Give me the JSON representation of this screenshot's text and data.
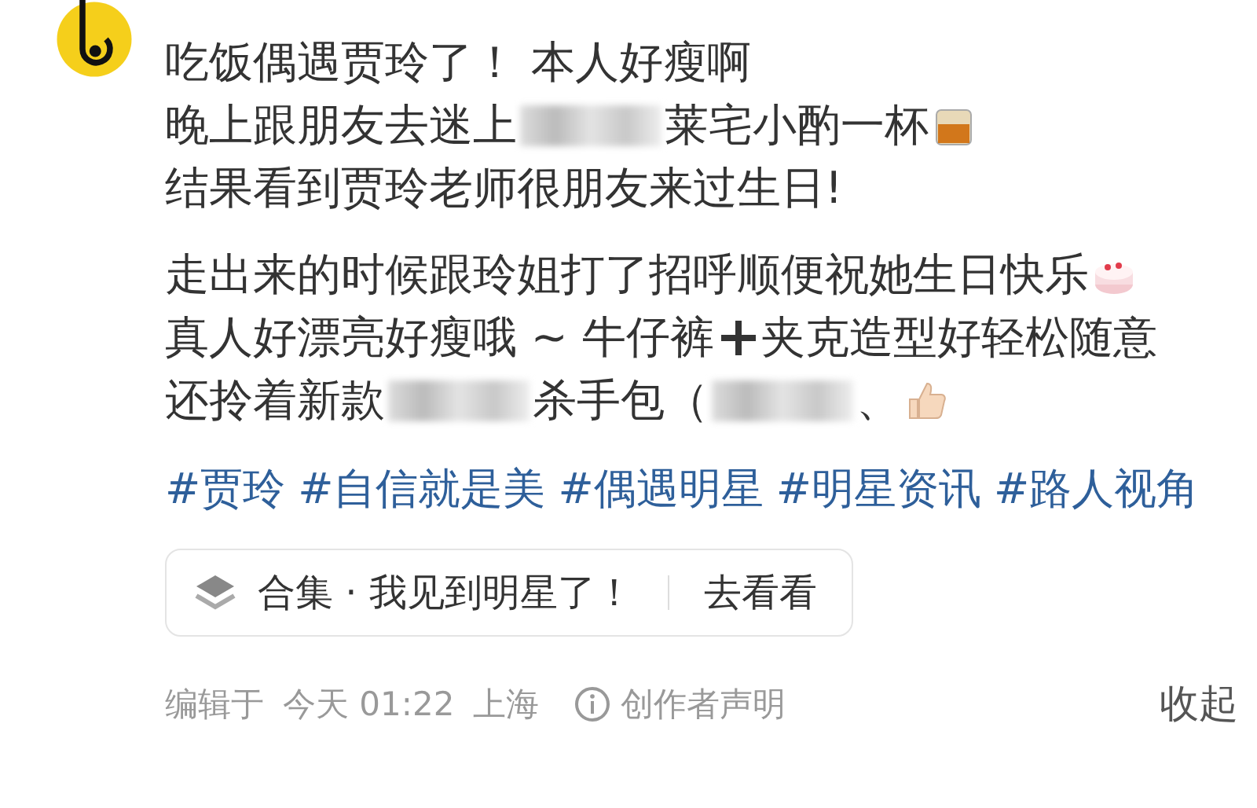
{
  "post": {
    "lines": [
      {
        "parts": [
          {
            "kind": "text",
            "text": "吃饭偶遇贾玲了！ 本人好瘦啊"
          }
        ]
      },
      {
        "parts": [
          {
            "kind": "text",
            "text": "晚上跟朋友去迷上"
          },
          {
            "kind": "blur"
          },
          {
            "kind": "text",
            "text": "莱宅小酌一杯"
          },
          {
            "kind": "glass"
          }
        ]
      },
      {
        "parts": [
          {
            "kind": "text",
            "text": "结果看到贾玲老师很朋友来过生日!"
          }
        ]
      },
      {
        "parts": [
          {
            "kind": "gap"
          }
        ]
      },
      {
        "parts": [
          {
            "kind": "text",
            "text": "走出来的时候跟玲姐打了招呼顺便祝她生日快乐"
          },
          {
            "kind": "cake"
          }
        ]
      },
      {
        "parts": [
          {
            "kind": "text",
            "text": "真人好漂亮好瘦哦 ~ 牛仔裤"
          },
          {
            "kind": "plus"
          },
          {
            "kind": "text",
            "text": "夹克造型好轻松随意"
          }
        ]
      },
      {
        "parts": [
          {
            "kind": "text",
            "text": "还拎着新款"
          },
          {
            "kind": "blur"
          },
          {
            "kind": "text",
            "text": "杀手包（"
          },
          {
            "kind": "blur"
          },
          {
            "kind": "text",
            "text": "、"
          },
          {
            "kind": "thumb"
          }
        ]
      }
    ],
    "tags": [
      "#贾玲",
      "#自信就是美",
      "#偶遇明星",
      "#明星资讯",
      "#路人视角"
    ],
    "collection": {
      "label": "合集 · 我见到明星了！",
      "action": "去看看"
    },
    "footer": {
      "edited": "编辑于",
      "time": "今天 01:22",
      "location": "上海",
      "statement": "创作者声明",
      "collapse": "收起"
    }
  }
}
